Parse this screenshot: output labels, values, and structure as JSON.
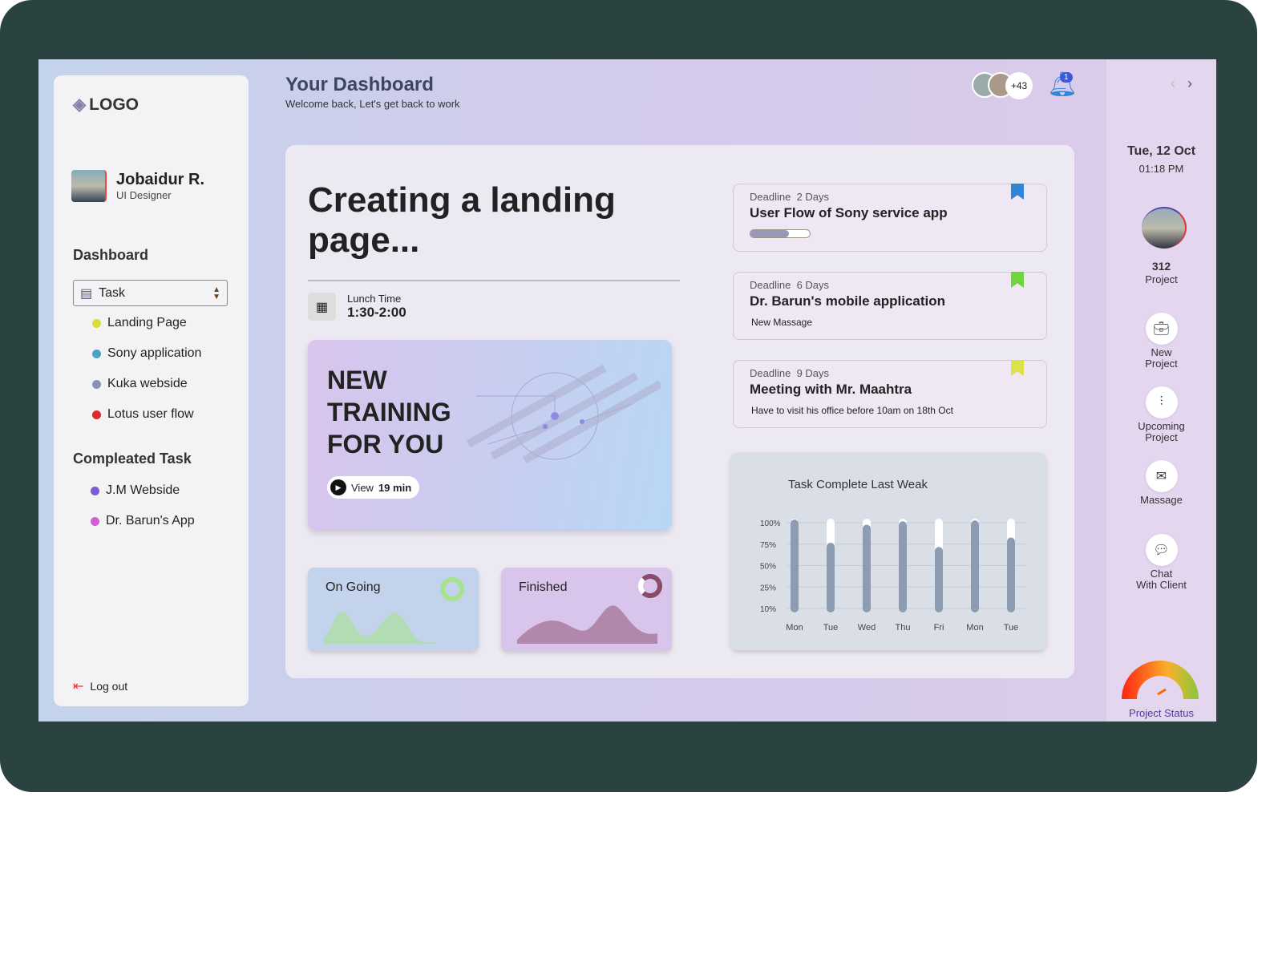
{
  "sidebar": {
    "logo": "LOGO",
    "user_name": "Jobaidur R.",
    "user_role": "UI Designer",
    "section1": "Dashboard",
    "select_value": "Task",
    "tasks": [
      {
        "label": "Landing Page",
        "color": "#d9dc3a"
      },
      {
        "label": "Sony application",
        "color": "#4aa3c4"
      },
      {
        "label": "Kuka webside",
        "color": "#8893b0"
      },
      {
        "label": "Lotus user flow",
        "color": "#d8292e"
      }
    ],
    "section2": "Compleated Task",
    "completed": [
      {
        "label": "J.M Webside",
        "color": "#7b5bd6"
      },
      {
        "label": "Dr. Barun's App",
        "color": "#d45ad8"
      }
    ],
    "logout": "Log out"
  },
  "header": {
    "title": "Your Dashboard",
    "subtitle": "Welcome back, Let's get back to work",
    "avatars_more": "+43",
    "notifications": "1"
  },
  "main": {
    "title": "Creating a landing page...",
    "lunch_label": "Lunch Time",
    "lunch_time": "1:30-2:00",
    "training": {
      "title_lines": [
        "NEW",
        "TRAINING",
        "FOR YOU"
      ],
      "view_label": "View",
      "duration": "19 min"
    },
    "ongoing": "On Going",
    "finished": "Finished",
    "cards": [
      {
        "deadline_label": "Deadline",
        "deadline": "2 Days",
        "title": "User Flow of Sony service app",
        "progress": 0.65,
        "bookmark_color": "#2f86d8"
      },
      {
        "deadline_label": "Deadline",
        "deadline": "6 Days",
        "title": "Dr. Barun's mobile application",
        "sub": "New Massage",
        "bookmark_color": "#6ed63c"
      },
      {
        "deadline_label": "Deadline",
        "deadline": "9 Days",
        "title": "Meeting with Mr. Maahtra",
        "sub": "Have to visit his office before 10am  on 18th Oct",
        "bookmark_color": "#dde24a"
      }
    ]
  },
  "chart_data": {
    "type": "bar",
    "title": "Task Complete Last Weak",
    "categories": [
      "Mon",
      "Tue",
      "Wed",
      "Thu",
      "Fri",
      "Mon",
      "Tue"
    ],
    "values": [
      99,
      72,
      93,
      97,
      67,
      98,
      78
    ],
    "ytick_labels": [
      "100%",
      "75%",
      "50%",
      "25%",
      "10%"
    ],
    "ylim": [
      0,
      100
    ],
    "grid": true,
    "bar_color": "#8b9cb3",
    "track_color": "#ffffff"
  },
  "right": {
    "date": "Tue, 12 Oct",
    "time": "01:18 PM",
    "projects_count": "312",
    "projects_label": "Project",
    "actions": [
      {
        "label": "New\nProject",
        "icon": "briefcase-icon"
      },
      {
        "label": "Upcoming\nProject",
        "icon": "kanban-icon"
      },
      {
        "label": "Massage",
        "icon": "envelope-icon"
      },
      {
        "label": "Chat\nWith Client",
        "icon": "chat-icon"
      }
    ],
    "status_label": "Project Status"
  }
}
